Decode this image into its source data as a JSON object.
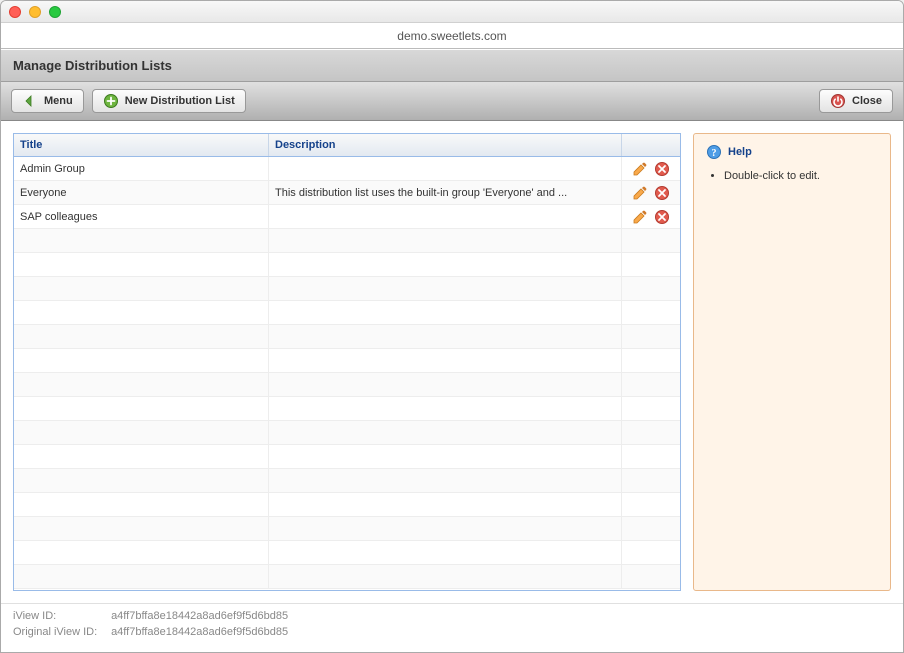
{
  "browser": {
    "url": "demo.sweetlets.com"
  },
  "header": {
    "title": "Manage Distribution Lists"
  },
  "toolbar": {
    "menu_label": "Menu",
    "new_label": "New Distribution List",
    "close_label": "Close"
  },
  "grid": {
    "columns": {
      "title": "Title",
      "description": "Description"
    },
    "rows": [
      {
        "title": "Admin Group",
        "description": ""
      },
      {
        "title": "Everyone",
        "description": "This distribution list uses the built-in group 'Everyone' and ..."
      },
      {
        "title": "SAP colleagues",
        "description": ""
      }
    ],
    "icons": {
      "edit": "pencil-icon",
      "delete": "delete-icon"
    }
  },
  "help": {
    "title": "Help",
    "items": [
      "Double-click to edit."
    ]
  },
  "footer": {
    "iview_id_label": "iView ID:",
    "iview_id": "a4ff7bffa8e18442a8ad6ef9f5d6bd85",
    "original_label": "Original iView ID:",
    "original_id": "a4ff7bffa8e18442a8ad6ef9f5d6bd85"
  }
}
